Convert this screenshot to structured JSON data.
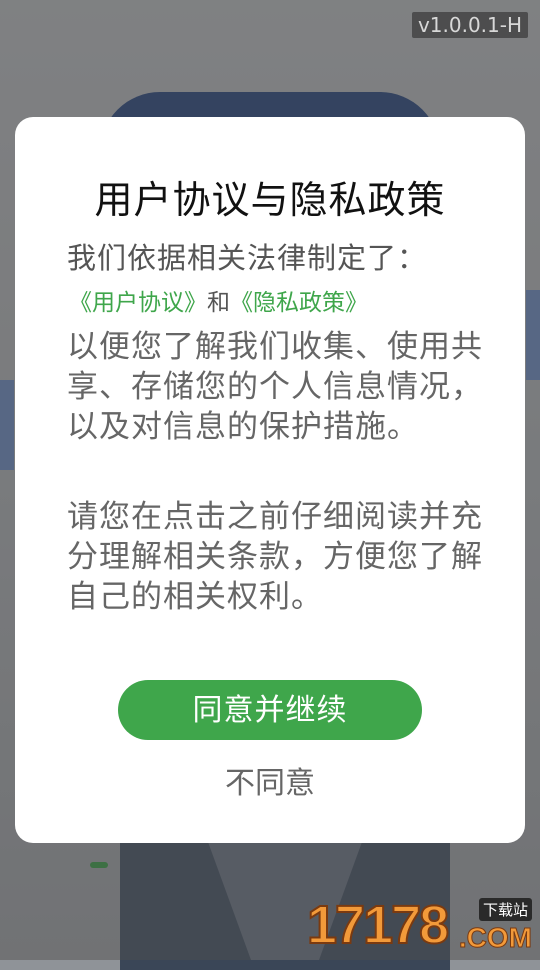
{
  "app": {
    "version": "v1.0.0.1-H"
  },
  "dialog": {
    "title": "用户协议与隐私政策",
    "intro": "我们依据相关法律制定了：",
    "user_agreement_link": "《用户协议》",
    "link_separator": "和",
    "privacy_policy_link": "《隐私政策》",
    "paragraph1": "以便您了解我们收集、使用共享、存储您的个人信息情况，以及对信息的保护措施。",
    "paragraph2": "请您在点击之前仔细阅读并充分理解相关条款，方便您了解自己的相关权利。",
    "agree_label": "同意并继续",
    "disagree_label": "不同意"
  },
  "watermark": {
    "number": "17178",
    "tag": "下载站",
    "domain": ".COM"
  },
  "colors": {
    "accent": "#3fa64b",
    "dialog_bg": "#ffffff",
    "overlay": "rgba(80,80,80,0.45)"
  }
}
